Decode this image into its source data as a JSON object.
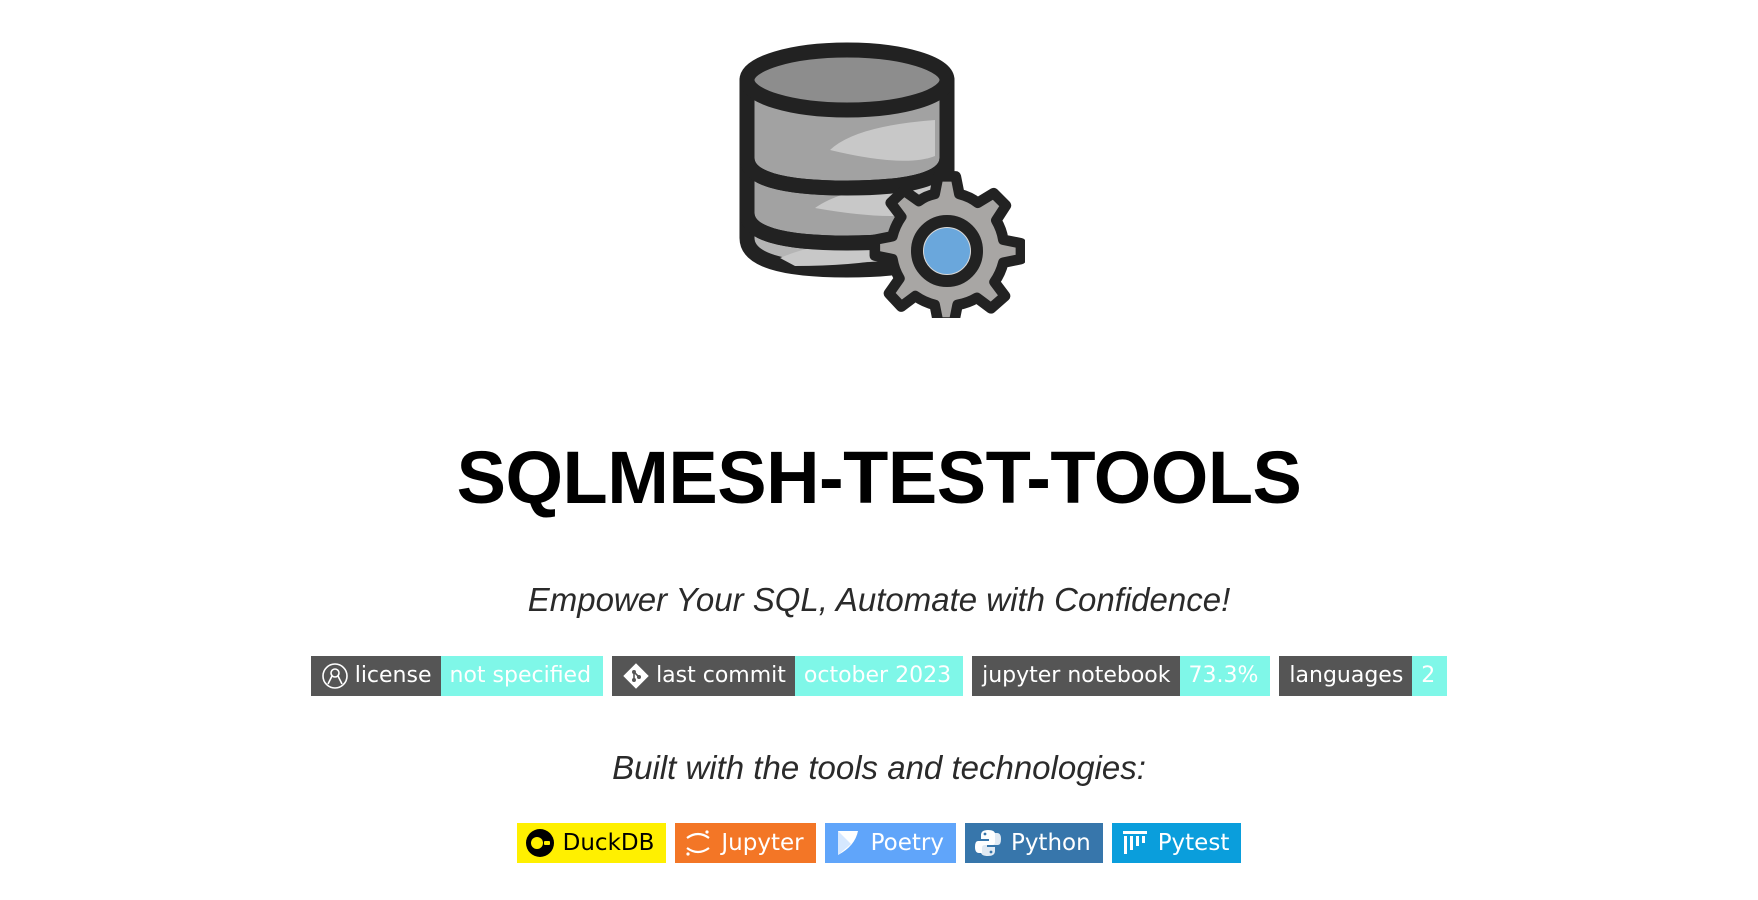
{
  "logo": {
    "icon": "database-gear-icon"
  },
  "title": "SQLMESH-TEST-TOOLS",
  "tagline": "Empower Your SQL, Automate with Confidence!",
  "badges": [
    {
      "label": "license",
      "value": "not specified",
      "icon": "license-icon"
    },
    {
      "label": "last commit",
      "value": "october 2023",
      "icon": "git-icon"
    },
    {
      "label": "jupyter notebook",
      "value": "73.3%",
      "icon": ""
    },
    {
      "label": "languages",
      "value": "2",
      "icon": ""
    }
  ],
  "badge_colors": {
    "label_bg": "#555555",
    "value_bg": "#7ff7e8"
  },
  "tools_heading": "Built with the tools and technologies:",
  "tools": [
    {
      "name": "DuckDB",
      "icon": "duckdb-icon",
      "bg": "#fff000",
      "fg": "#000000"
    },
    {
      "name": "Jupyter",
      "icon": "jupyter-icon",
      "bg": "#f37626",
      "fg": "#ffffff"
    },
    {
      "name": "Poetry",
      "icon": "poetry-icon",
      "bg": "#60a5fa",
      "fg": "#ffffff"
    },
    {
      "name": "Python",
      "icon": "python-icon",
      "bg": "#3776ab",
      "fg": "#ffffff"
    },
    {
      "name": "Pytest",
      "icon": "pytest-icon",
      "bg": "#0a9edc",
      "fg": "#ffffff"
    }
  ]
}
